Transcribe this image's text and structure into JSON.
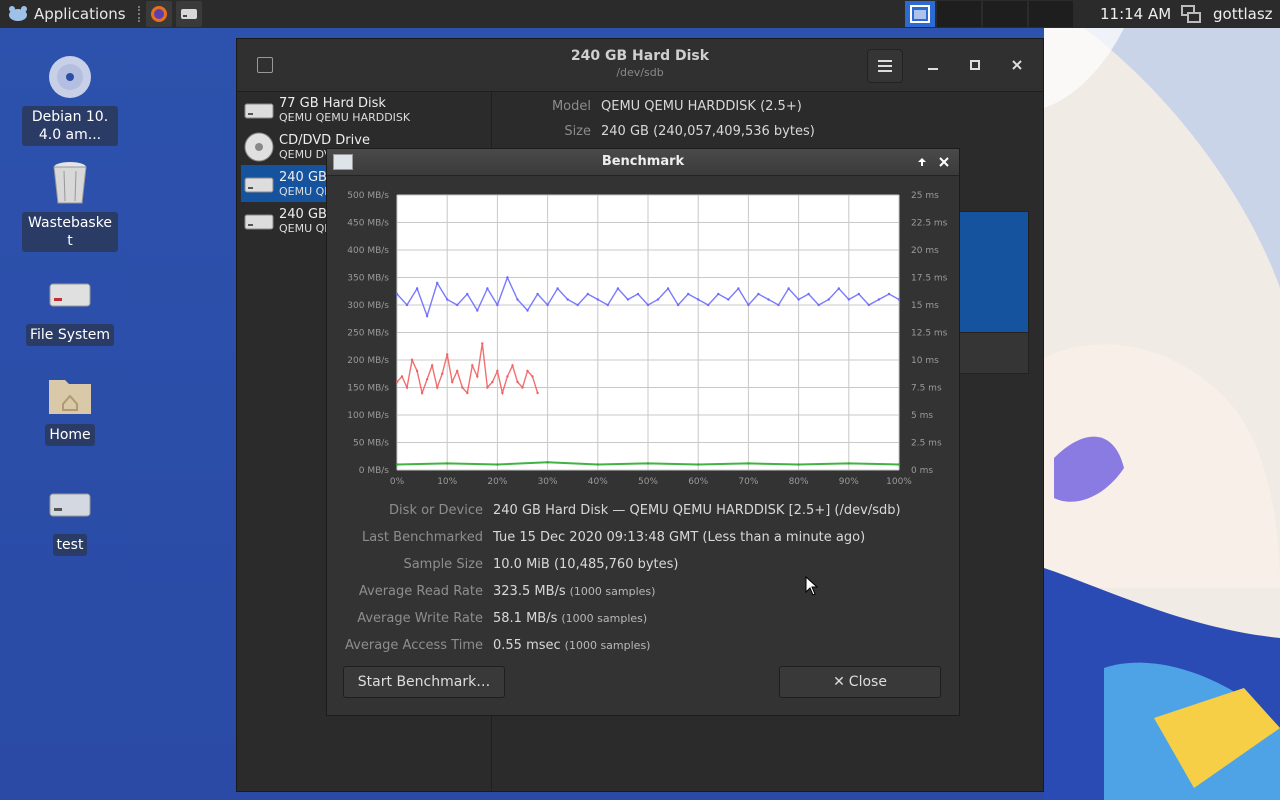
{
  "top_panel": {
    "applications_label": "Applications",
    "clock": "11:14 AM",
    "username": "gottlasz"
  },
  "desktop": {
    "icons": [
      {
        "label": "Debian 10.4.0 am..."
      },
      {
        "label": "Wastebasket"
      },
      {
        "label": "File System"
      },
      {
        "label": "Home"
      },
      {
        "label": "test"
      }
    ]
  },
  "disks_window": {
    "title": "240 GB Hard Disk",
    "subtitle": "/dev/sdb",
    "devices": [
      {
        "name": "77 GB Hard Disk",
        "sub": "QEMU QEMU HARDDISK"
      },
      {
        "name": "CD/DVD Drive",
        "sub": "QEMU DVD-ROM"
      },
      {
        "name": "240 GB Hard Disk",
        "sub": "QEMU QEMU HARDDISK"
      },
      {
        "name": "240 GB Hard Disk",
        "sub": "QEMU QEMU HARDDISK"
      }
    ],
    "info": {
      "model_label": "Model",
      "model_value": "QEMU QEMU HARDDISK (2.5+)",
      "size_label": "Size",
      "size_value": "240 GB (240,057,409,536 bytes)"
    }
  },
  "benchmark": {
    "title": "Benchmark",
    "rows": [
      {
        "label": "Disk or Device",
        "value": "240 GB Hard Disk — QEMU QEMU HARDDISK [2.5+] (/dev/sdb)",
        "suffix": ""
      },
      {
        "label": "Last Benchmarked",
        "value": "Tue 15 Dec 2020 09:13:48 GMT (Less than a minute ago)",
        "suffix": ""
      },
      {
        "label": "Sample Size",
        "value": "10.0 MiB (10,485,760 bytes)",
        "suffix": ""
      },
      {
        "label": "Average Read Rate",
        "value": "323.5 MB/s",
        "suffix": "(1000 samples)"
      },
      {
        "label": "Average Write Rate",
        "value": "58.1 MB/s",
        "suffix": "(1000 samples)"
      },
      {
        "label": "Average Access Time",
        "value": "0.55 msec",
        "suffix": "(1000 samples)"
      }
    ],
    "start_button": "Start Benchmark…",
    "close_button": "Close",
    "close_glyph": "✕"
  },
  "chart_data": {
    "type": "line",
    "x_ticks": [
      "0%",
      "10%",
      "20%",
      "30%",
      "40%",
      "50%",
      "60%",
      "70%",
      "80%",
      "90%",
      "100%"
    ],
    "y_left_ticks": [
      "0 MB/s",
      "50 MB/s",
      "100 MB/s",
      "150 MB/s",
      "200 MB/s",
      "250 MB/s",
      "300 MB/s",
      "350 MB/s",
      "400 MB/s",
      "450 MB/s",
      "500 MB/s"
    ],
    "y_right_ticks": [
      "0 ms",
      "2.5 ms",
      "5 ms",
      "7.5 ms",
      "10 ms",
      "12.5 ms",
      "15 ms",
      "17.5 ms",
      "20 ms",
      "22.5 ms",
      "25 ms"
    ],
    "ylim_left": [
      0,
      500
    ],
    "ylim_right": [
      0,
      25
    ],
    "xlim": [
      0,
      100
    ],
    "grid": true,
    "series": [
      {
        "color": "#6b6bff",
        "x": [
          0,
          2,
          4,
          6,
          8,
          10,
          12,
          14,
          16,
          18,
          20,
          22,
          24,
          26,
          28,
          30,
          32,
          34,
          36,
          38,
          40,
          42,
          44,
          46,
          48,
          50,
          52,
          54,
          56,
          58,
          60,
          62,
          64,
          66,
          68,
          70,
          72,
          74,
          76,
          78,
          80,
          82,
          84,
          86,
          88,
          90,
          92,
          94,
          96,
          98,
          100
        ],
        "values": [
          320,
          300,
          330,
          280,
          340,
          310,
          300,
          320,
          290,
          330,
          300,
          350,
          310,
          290,
          320,
          300,
          330,
          310,
          300,
          320,
          310,
          300,
          330,
          310,
          320,
          300,
          310,
          330,
          300,
          320,
          310,
          300,
          320,
          310,
          330,
          300,
          320,
          310,
          300,
          330,
          310,
          320,
          300,
          310,
          330,
          310,
          320,
          300,
          310,
          320,
          310
        ]
      },
      {
        "color": "#f06060",
        "x": [
          0,
          1,
          2,
          3,
          4,
          5,
          6,
          7,
          8,
          9,
          10,
          11,
          12,
          13,
          14,
          15,
          16,
          17,
          18,
          19,
          20,
          21,
          22,
          23,
          24,
          25,
          26,
          27,
          28
        ],
        "values": [
          160,
          170,
          150,
          200,
          180,
          140,
          165,
          190,
          150,
          175,
          210,
          160,
          180,
          150,
          140,
          190,
          170,
          230,
          150,
          160,
          180,
          140,
          170,
          190,
          160,
          150,
          180,
          170,
          140
        ]
      },
      {
        "color": "#2eaa2e",
        "x": [
          0,
          10,
          20,
          30,
          40,
          50,
          60,
          70,
          80,
          90,
          100
        ],
        "values": [
          0.5,
          0.6,
          0.5,
          0.7,
          0.5,
          0.6,
          0.5,
          0.6,
          0.5,
          0.6,
          0.5
        ]
      }
    ]
  },
  "colors": {
    "accent": "#15539e",
    "read_series": "#6b6bff",
    "write_series": "#f06060",
    "access_series": "#2eaa2e"
  }
}
